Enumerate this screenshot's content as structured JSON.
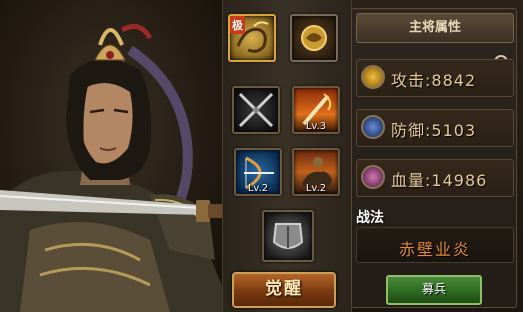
{
  "panel": {
    "title": "主将属性",
    "stats": [
      {
        "label": "攻击",
        "value": "8842",
        "icon": "attack-icon"
      },
      {
        "label": "防御",
        "value": "5103",
        "icon": "defense-icon"
      },
      {
        "label": "血量",
        "value": "14986",
        "icon": "hp-icon"
      }
    ],
    "tactic_title": "战法",
    "tactic_name": "赤壁业炎",
    "recruit_label": "募兵"
  },
  "skills": [
    {
      "name": "极-dragon-skill",
      "level": ""
    },
    {
      "name": "golden-beast-skill",
      "level": ""
    },
    {
      "name": "crossed-swords-skill",
      "level": ""
    },
    {
      "name": "flame-sword-skill",
      "level": "Lv.3"
    },
    {
      "name": "bow-skill",
      "level": "Lv.2"
    },
    {
      "name": "cavalry-skill",
      "level": "Lv.2"
    },
    {
      "name": "armor-skill",
      "level": ""
    }
  ],
  "badge_text": "极",
  "awaken_label": "觉醒",
  "colors": {
    "gold": "#e6c999",
    "tactic": "#e08b3a",
    "recruit": "#2e6a22",
    "awaken": "#7a3a12"
  }
}
